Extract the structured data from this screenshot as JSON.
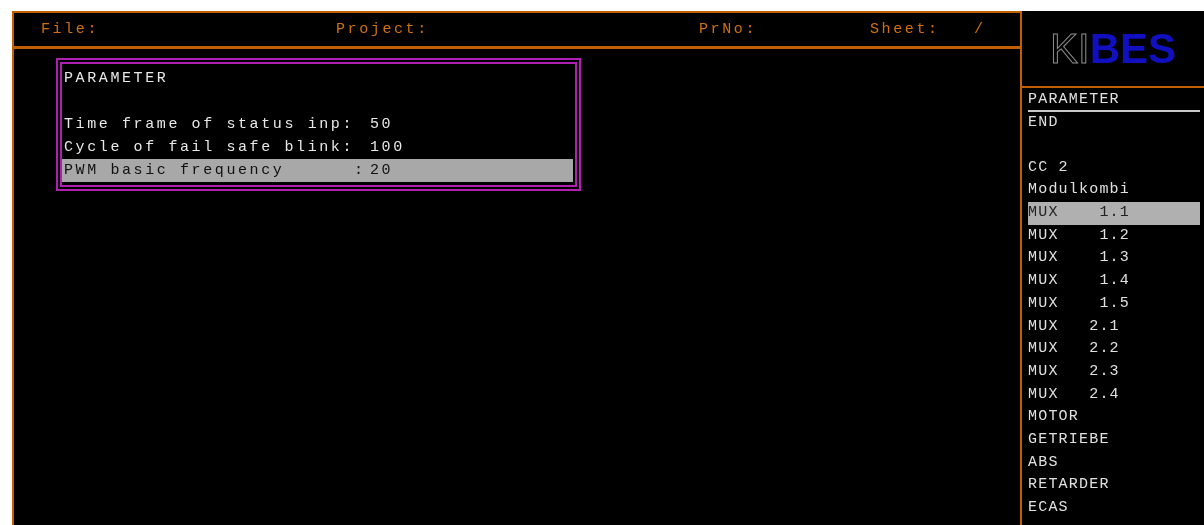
{
  "header": {
    "fields": [
      {
        "label": "File:"
      },
      {
        "label": "Project:"
      },
      {
        "label": "PrNo:"
      },
      {
        "label": "Sheet:"
      },
      {
        "label": "/"
      }
    ]
  },
  "logo": {
    "outline": "KI",
    "solid": "BES"
  },
  "parameter_box": {
    "title": "PARAMETER",
    "rows": [
      {
        "label": "Time frame of status inp:",
        "value": "50",
        "selected": false
      },
      {
        "label": "Cycle of fail safe blink:",
        "value": "100",
        "selected": false
      },
      {
        "label": "PWM basic frequency      :",
        "value": "20",
        "selected": true
      }
    ]
  },
  "menu": {
    "title": "PARAMETER",
    "items": [
      {
        "text": "END",
        "selected": false
      }
    ]
  },
  "modules": [
    {
      "text": "CC 2",
      "selected": false
    },
    {
      "text": "Modulkombi",
      "selected": false
    },
    {
      "text": "MUX    1.1",
      "selected": true
    },
    {
      "text": "MUX    1.2",
      "selected": false
    },
    {
      "text": "MUX    1.3",
      "selected": false
    },
    {
      "text": "MUX    1.4",
      "selected": false
    },
    {
      "text": "MUX    1.5",
      "selected": false
    },
    {
      "text": "MUX   2.1",
      "selected": false
    },
    {
      "text": "MUX   2.2",
      "selected": false
    },
    {
      "text": "MUX   2.3",
      "selected": false
    },
    {
      "text": "MUX   2.4",
      "selected": false
    },
    {
      "text": "MOTOR",
      "selected": false
    },
    {
      "text": "GETRIEBE",
      "selected": false
    },
    {
      "text": "ABS",
      "selected": false
    },
    {
      "text": "RETARDER",
      "selected": false
    },
    {
      "text": "ECAS",
      "selected": false
    }
  ]
}
